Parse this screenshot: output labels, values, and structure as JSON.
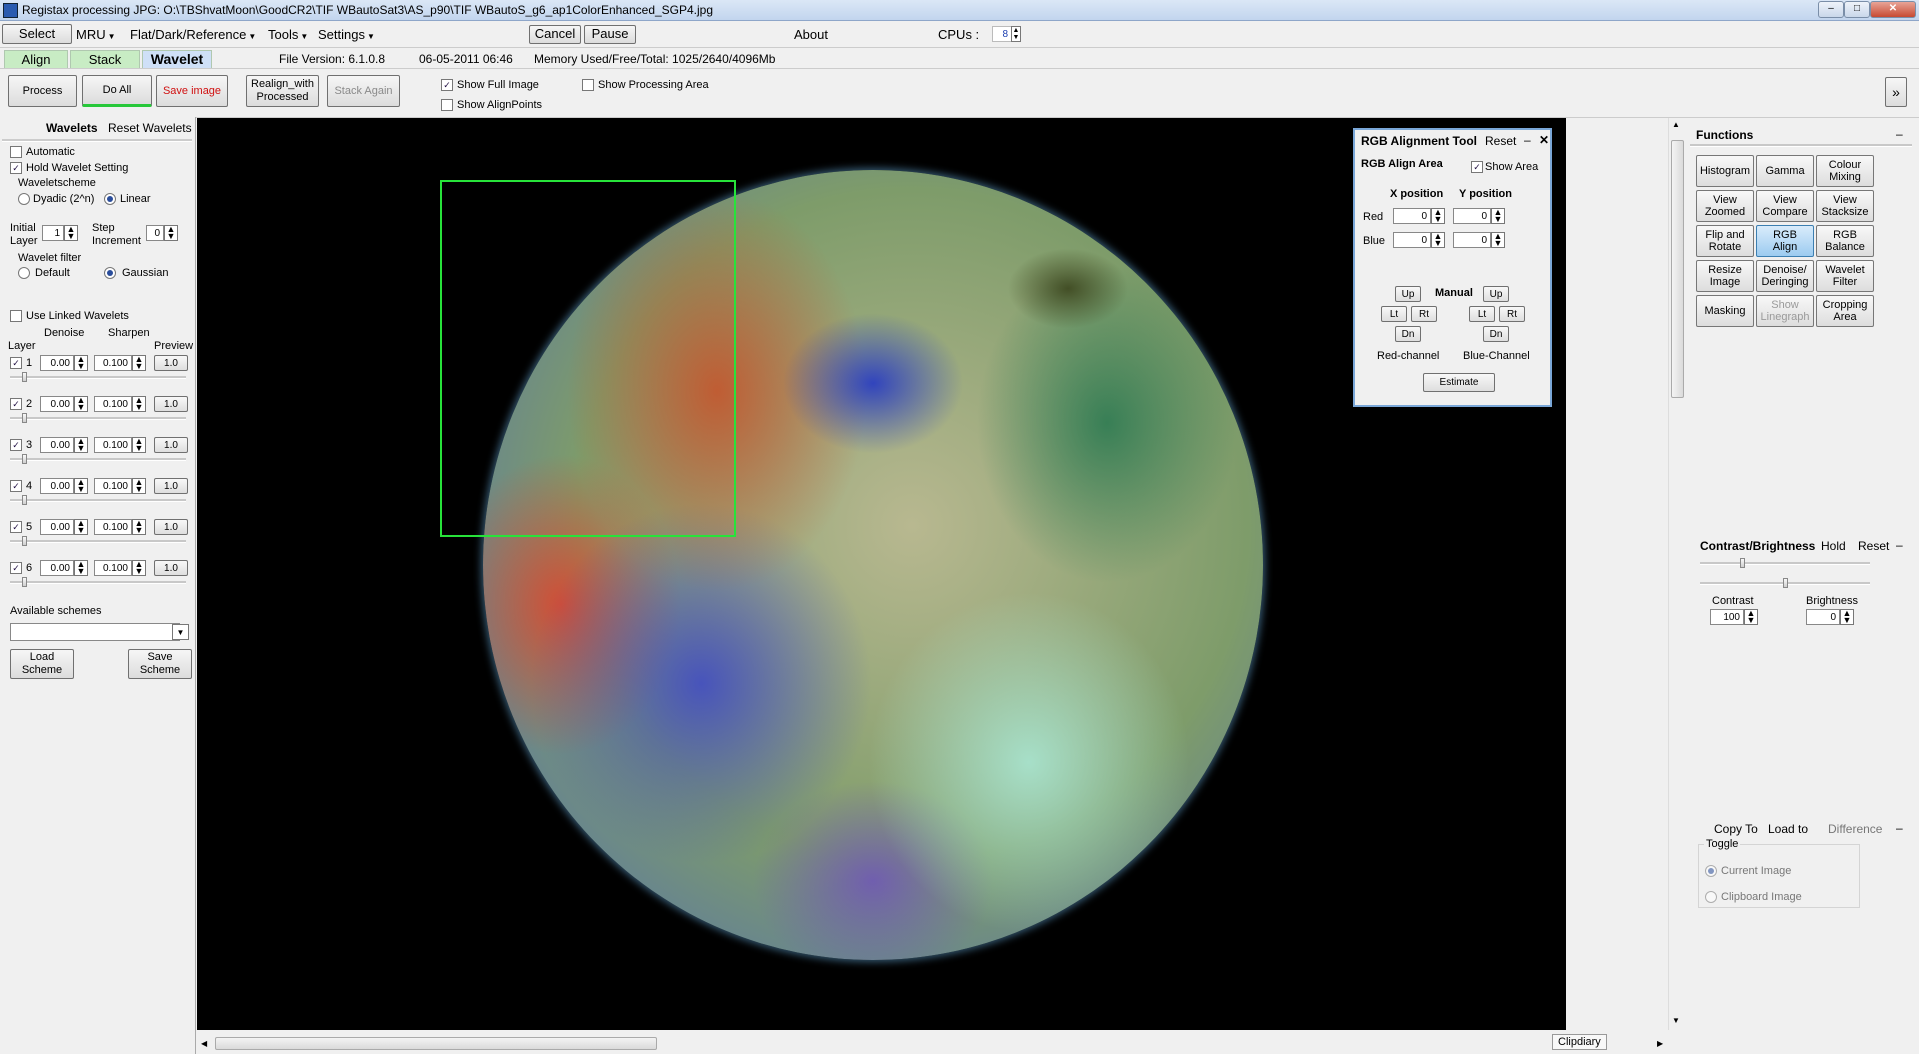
{
  "window": {
    "title": "Registax processing JPG: O:\\TBShvatMoon\\GoodCR2\\TIF WBautoSat3\\AS_p90\\TIF WBautoS_g6_ap1ColorEnhanced_SGP4.jpg",
    "minimize": "–",
    "maximize": "□",
    "close": "✕"
  },
  "menu": {
    "select": "Select",
    "mru": "MRU",
    "flat": "Flat/Dark/Reference",
    "tools": "Tools",
    "settings": "Settings",
    "cancel": "Cancel",
    "pause": "Pause",
    "about": "About",
    "cpus_label": "CPUs :",
    "cpus_value": "8"
  },
  "tabs": {
    "align": "Align",
    "stack": "Stack",
    "wavelet": "Wavelet",
    "file_version": "File Version: 6.1.0.8",
    "datetime": "06-05-2011 06:46",
    "memory": "Memory Used/Free/Total: 1025/2640/4096Mb"
  },
  "toolbar": {
    "process": "Process",
    "do_all": "Do All",
    "save_image": "Save image",
    "realign_1": "Realign_with",
    "realign_2": "Processed",
    "stack_again": "Stack Again",
    "show_full_image": "Show Full Image",
    "show_alignpoints": "Show AlignPoints",
    "show_processing_area": "Show Processing Area",
    "expand": "»"
  },
  "wavelets": {
    "title": "Wavelets",
    "reset": "Reset Wavelets",
    "automatic": "Automatic",
    "hold": "Hold Wavelet Setting",
    "scheme_label": "Waveletscheme",
    "dyadic": "Dyadic (2^n)",
    "linear": "Linear",
    "initial_layer_1": "Initial",
    "initial_layer_2": "Layer",
    "initial_layer_value": "1",
    "step_inc_1": "Step",
    "step_inc_2": "Increment",
    "step_inc_value": "0",
    "filter_label": "Wavelet filter",
    "default": "Default",
    "gaussian": "Gaussian",
    "use_linked": "Use Linked Wavelets",
    "col_denoise": "Denoise",
    "col_sharpen": "Sharpen",
    "col_layer": "Layer",
    "col_preview": "Preview",
    "layers": [
      {
        "num": "1",
        "denoise": "0.00",
        "sharpen": "0.100",
        "preview": "1.0"
      },
      {
        "num": "2",
        "denoise": "0.00",
        "sharpen": "0.100",
        "preview": "1.0"
      },
      {
        "num": "3",
        "denoise": "0.00",
        "sharpen": "0.100",
        "preview": "1.0"
      },
      {
        "num": "4",
        "denoise": "0.00",
        "sharpen": "0.100",
        "preview": "1.0"
      },
      {
        "num": "5",
        "denoise": "0.00",
        "sharpen": "0.100",
        "preview": "1.0"
      },
      {
        "num": "6",
        "denoise": "0.00",
        "sharpen": "0.100",
        "preview": "1.0"
      }
    ],
    "available_schemes": "Available schemes",
    "load_1": "Load",
    "load_2": "Scheme",
    "save_1": "Save",
    "save_2": "Scheme"
  },
  "rgb_tool": {
    "title": "RGB Alignment Tool",
    "reset": "Reset",
    "min": "–",
    "close": "✕",
    "align_area": "RGB Align Area",
    "show_area": "Show Area",
    "x_position": "X position",
    "y_position": "Y position",
    "red": "Red",
    "blue": "Blue",
    "red_x": "0",
    "red_y": "0",
    "blue_x": "0",
    "blue_y": "0",
    "manual": "Manual",
    "up": "Up",
    "lt": "Lt",
    "rt": "Rt",
    "dn": "Dn",
    "red_channel": "Red-channel",
    "blue_channel": "Blue-Channel",
    "estimate": "Estimate"
  },
  "functions": {
    "title": "Functions",
    "min": "–",
    "buttons": [
      [
        "Histogram",
        ""
      ],
      [
        "Gamma",
        ""
      ],
      [
        "Colour",
        "Mixing"
      ],
      [
        "View",
        "Zoomed"
      ],
      [
        "View",
        "Compare"
      ],
      [
        "View",
        "Stacksize"
      ],
      [
        "Flip and",
        "Rotate"
      ],
      [
        "RGB",
        "Align"
      ],
      [
        "RGB",
        "Balance"
      ],
      [
        "Resize",
        "Image"
      ],
      [
        "Denoise/",
        "Deringing"
      ],
      [
        "Wavelet",
        "Filter"
      ],
      [
        "Masking",
        ""
      ],
      [
        "Show",
        "Linegraph"
      ],
      [
        "Cropping",
        "Area"
      ]
    ]
  },
  "contrast": {
    "title": "Contrast/Brightness",
    "hold": "Hold",
    "reset": "Reset",
    "min": "–",
    "contrast_label": "Contrast",
    "contrast_value": "100",
    "brightness_label": "Brightness",
    "brightness_value": "0"
  },
  "copy": {
    "copy_to": "Copy To",
    "load_to": "Load to",
    "difference": "Difference",
    "min": "–",
    "toggle": "Toggle",
    "current": "Current Image",
    "clipboard": "Clipboard Image"
  },
  "tooltip": "Clipdiary",
  "colors": {
    "accent_active": "#9ccbf0",
    "tab_green": "#c8ecc4",
    "align_box": "#27e33a",
    "save_red": "#d01010"
  }
}
